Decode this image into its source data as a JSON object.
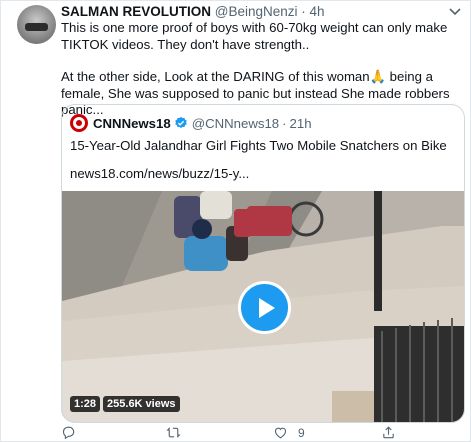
{
  "tweet": {
    "author_name": "SALMAN REVOLUTION",
    "author_handle": "@BeingNenzi",
    "separator": "·",
    "time": "4h",
    "text_paragraph_1": "This is one more proof of boys with 60-70kg weight can only make TIKTOK videos. They don't have strength..",
    "text_paragraph_2": "At the other side, Look at the DARING of this woman🙏 being a female, She was supposed to panic but instead She made robbers panic..."
  },
  "quoted_tweet": {
    "author_name": "CNNNews18",
    "author_handle": "@CNNnews18",
    "separator": "·",
    "time": "21h",
    "title": "15-Year-Old Jalandhar Girl Fights Two Mobile Snatchers on Bike",
    "link": "news18.com/news/buzz/15-y...",
    "video": {
      "duration": "1:28",
      "views": "255.6K views"
    }
  },
  "actions": {
    "reply_count": "",
    "retweet_count": "",
    "like_count": "9",
    "share_count": ""
  },
  "colors": {
    "accent": "#1d9bf0",
    "text_primary": "#0f1419",
    "text_secondary": "#536471",
    "border": "#cfd9de"
  },
  "icons": [
    "avatar",
    "chevron-down-icon",
    "verified-badge-icon",
    "play-icon",
    "reply-icon",
    "retweet-icon",
    "like-icon",
    "share-icon"
  ]
}
